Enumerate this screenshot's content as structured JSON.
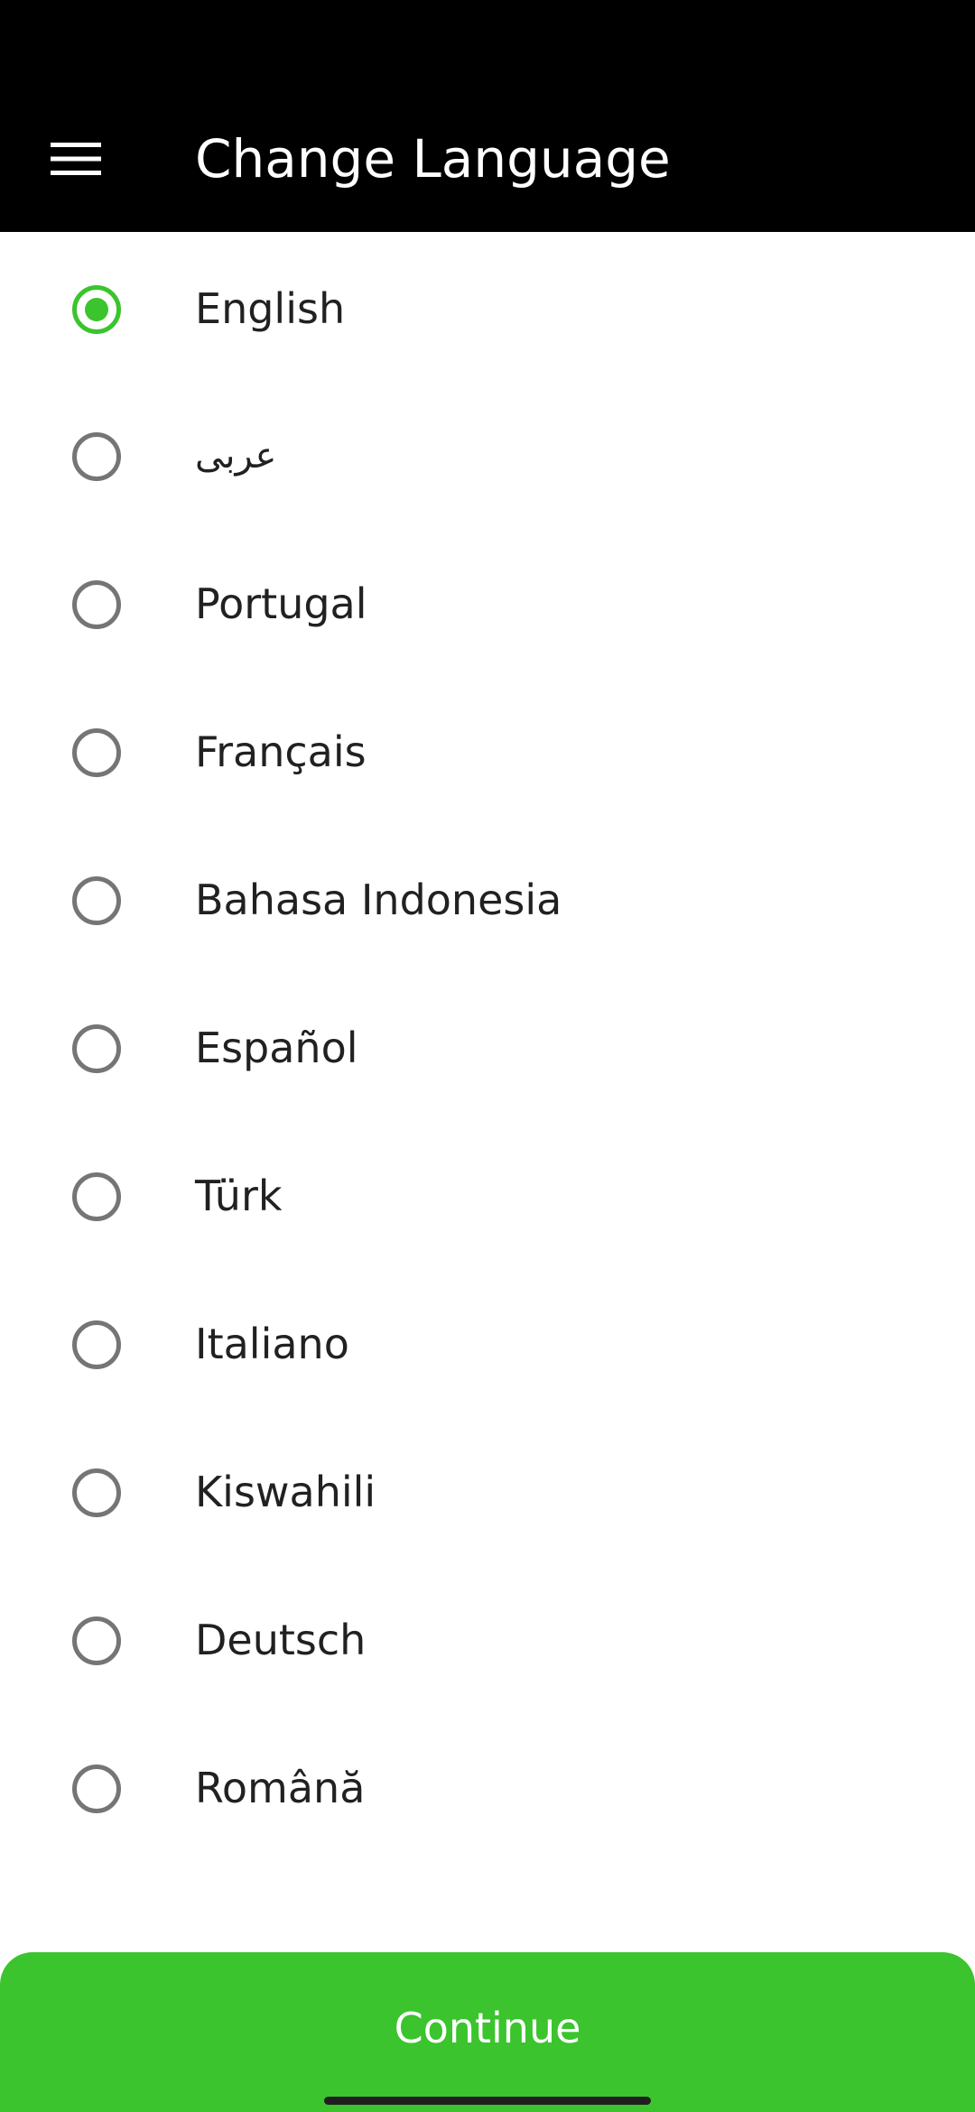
{
  "appbar": {
    "title": "Change Language",
    "menu_icon": "hamburger-menu-icon",
    "background": "#000000"
  },
  "languages": {
    "selected_index": 0,
    "items": [
      {
        "label": "English",
        "selected": true
      },
      {
        "label": "عربى",
        "selected": false
      },
      {
        "label": "Portugal",
        "selected": false
      },
      {
        "label": "Français",
        "selected": false
      },
      {
        "label": "Bahasa Indonesia",
        "selected": false
      },
      {
        "label": "Español",
        "selected": false
      },
      {
        "label": "Türk",
        "selected": false
      },
      {
        "label": "Italiano",
        "selected": false
      },
      {
        "label": "Kiswahili",
        "selected": false
      },
      {
        "label": "Deutsch",
        "selected": false
      },
      {
        "label": "Română",
        "selected": false
      }
    ]
  },
  "footer": {
    "continue_label": "Continue"
  },
  "colors": {
    "accent": "#3bc42d",
    "radio_unselected": "#757575",
    "text": "#212121"
  }
}
